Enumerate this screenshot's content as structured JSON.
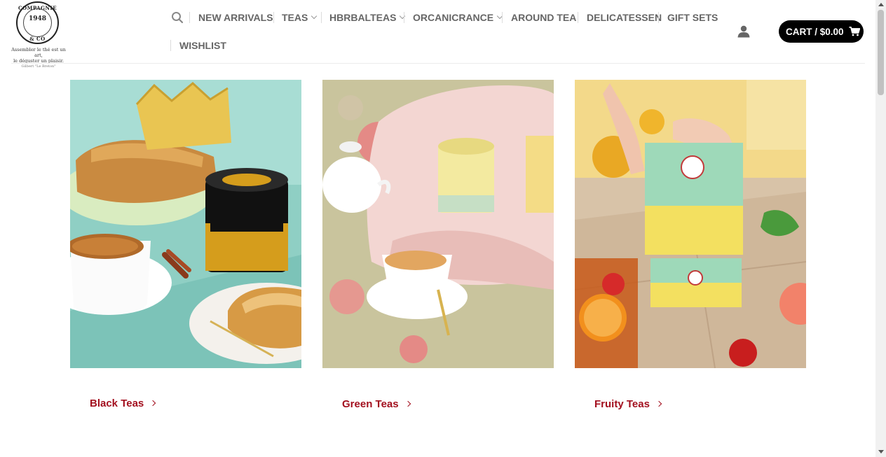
{
  "brand": {
    "logo_ring_top": "COMPAGNIE",
    "logo_ring_bottom": "& CO",
    "logo_year": "1948",
    "tagline_line1": "Assembler le thé est un art,",
    "tagline_line2": "le déguster un plaisir.",
    "tagline_signature": "Gilbert \"Le Breton\""
  },
  "nav": {
    "search_icon": "search-icon",
    "items": [
      {
        "label": "NEW ARRIVALS",
        "has_dropdown": false
      },
      {
        "label": "TEAS",
        "has_dropdown": true
      },
      {
        "label": "HBRBALTEAS",
        "has_dropdown": true
      },
      {
        "label": "ORCANICRANCE",
        "has_dropdown": true
      },
      {
        "label": "AROUND TEA",
        "has_dropdown": false
      },
      {
        "label": "DELICATESSEN",
        "has_dropdown": false
      },
      {
        "label": "GIFT SETS",
        "has_dropdown": false
      },
      {
        "label": "WISHLIST",
        "has_dropdown": false
      }
    ]
  },
  "account": {
    "icon": "user-icon"
  },
  "cart": {
    "label": "CART / $0.00",
    "icon": "cart-icon"
  },
  "categories": [
    {
      "label": "Black Teas",
      "image": "black-tea-tin-with-galette-photo"
    },
    {
      "label": "Green Teas",
      "image": "green-tea-tin-with-teapot-photo"
    },
    {
      "label": "Fruity Teas",
      "image": "fruity-tea-box-with-iced-tea-photo"
    }
  ],
  "colors": {
    "link": "#a3101f",
    "nav_text": "#666666",
    "cart_bg": "#000000"
  }
}
